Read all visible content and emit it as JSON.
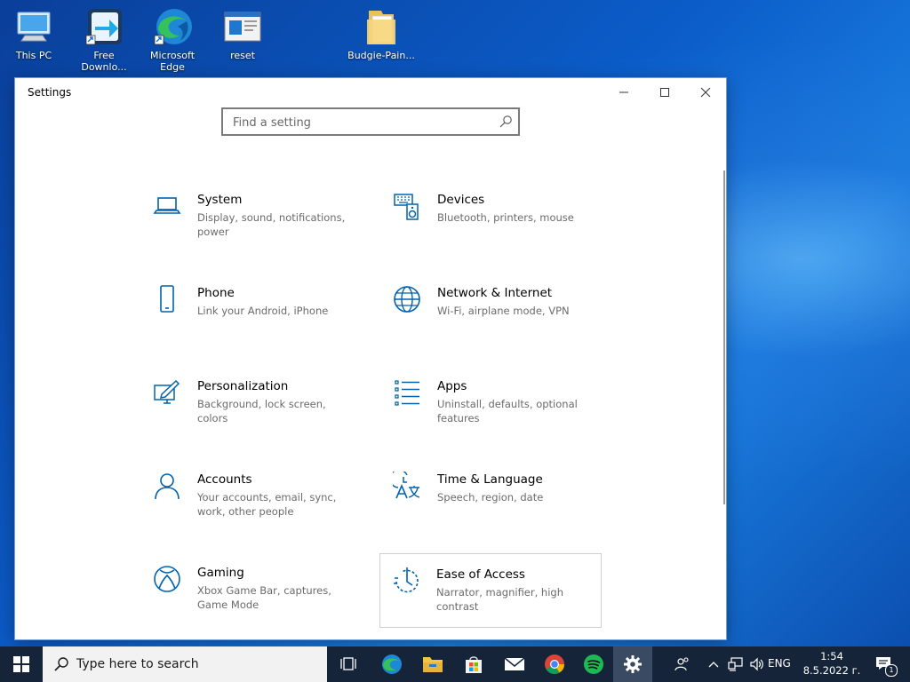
{
  "desktop": {
    "icons": [
      {
        "label_1": "This PC",
        "label_2": "",
        "icon": "this-pc-icon"
      },
      {
        "label_1": "Free",
        "label_2": "Downlo...",
        "icon": "free-download-manager-icon"
      },
      {
        "label_1": "Microsoft",
        "label_2": "Edge",
        "icon": "edge-icon"
      },
      {
        "label_1": "reset",
        "label_2": "",
        "icon": "reset-window-icon"
      },
      {
        "label_1": "Budgie-Pain...",
        "label_2": "",
        "icon": "folder-icon"
      }
    ]
  },
  "window": {
    "title": "Settings",
    "controls": {
      "minimize": "minimize-icon",
      "maximize": "maximize-icon",
      "close": "close-icon"
    },
    "search": {
      "placeholder": "Find a setting"
    }
  },
  "tiles": [
    {
      "title": "System",
      "desc": "Display, sound, notifications, power",
      "icon": "laptop-icon"
    },
    {
      "title": "Devices",
      "desc": "Bluetooth, printers, mouse",
      "icon": "keyboard-speaker-icon"
    },
    {
      "title": "Phone",
      "desc": "Link your Android, iPhone",
      "icon": "phone-icon"
    },
    {
      "title": "Network & Internet",
      "desc": "Wi-Fi, airplane mode, VPN",
      "icon": "globe-icon"
    },
    {
      "title": "Personalization",
      "desc": "Background, lock screen, colors",
      "icon": "paint-pen-icon"
    },
    {
      "title": "Apps",
      "desc": "Uninstall, defaults, optional features",
      "icon": "apps-list-icon"
    },
    {
      "title": "Accounts",
      "desc": "Your accounts, email, sync, work, other people",
      "icon": "person-icon"
    },
    {
      "title": "Time & Language",
      "desc": "Speech, region, date",
      "icon": "time-language-icon"
    },
    {
      "title": "Gaming",
      "desc": "Xbox Game Bar, captures, Game Mode",
      "icon": "xbox-icon"
    },
    {
      "title": "Ease of Access",
      "desc": "Narrator, magnifier, high contrast",
      "icon": "ease-of-access-icon"
    }
  ],
  "taskbar": {
    "search_text": "Type here to search",
    "lang": "ENG",
    "time": "1:54",
    "date": "8.5.2022 г.",
    "notification_count": "1"
  },
  "colors": {
    "accent": "#0063b1",
    "taskbar": "#16243a"
  }
}
